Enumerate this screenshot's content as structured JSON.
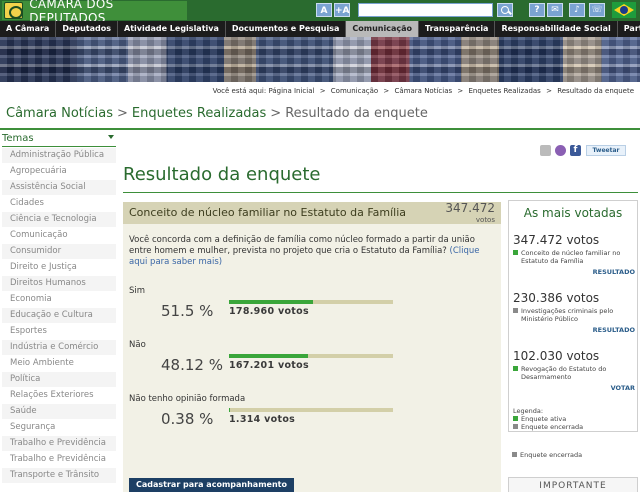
{
  "header": {
    "site_name": "CÂMARA DOS DEPUTADOS",
    "font_small": "A",
    "font_large": "+A",
    "search_placeholder": "",
    "tools": [
      "?",
      "✉",
      "♪",
      "☏"
    ]
  },
  "nav": [
    "A Câmara",
    "Deputados",
    "Atividade Legislativa",
    "Documentos e Pesquisa",
    "Comunicação",
    "Transparência",
    "Responsabilidade Social",
    "Participe"
  ],
  "nav_active_index": 4,
  "breadcrumb": {
    "prefix": "Você está aqui:",
    "items": [
      "Página Inicial",
      "Comunicação",
      "Câmara Notícias",
      "Enquetes Realizadas",
      "Resultado da enquete"
    ],
    "separator": ">"
  },
  "section": {
    "part1": "Câmara Notícias",
    "part2": "Enquetes Realizadas",
    "part3": "Resultado da enquete",
    "separator": ">"
  },
  "sidebar": {
    "title": "Temas",
    "items": [
      "Administração Pública",
      "Agropecuária",
      "Assistência Social",
      "Cidades",
      "Ciência e Tecnologia",
      "Comunicação",
      "Consumidor",
      "Direito e Justiça",
      "Direitos Humanos",
      "Economia",
      "Educação e Cultura",
      "Esportes",
      "Indústria e Comércio",
      "Meio Ambiente",
      "Política",
      "Relações Exteriores",
      "Saúde",
      "Segurança",
      "Trabalho e Previdência",
      "Trabalho e Previdência",
      "Transporte e Trânsito"
    ]
  },
  "share": {
    "tweet_label": "Tweetar"
  },
  "page_title": "Resultado da enquete",
  "poll": {
    "question": "Conceito de núcleo familiar no Estatuto da Família",
    "total_votes": "347.472",
    "total_votes_label": "votos",
    "description": "Você concorda com a definição de família como núcleo formado a partir da união entre homem e mulher, prevista no projeto que cria o Estatuto da Família?",
    "link_text": "(Clique aqui para saber mais)",
    "options": [
      {
        "label": "Sim",
        "percent": "51.5 %",
        "fraction": 0.515,
        "votes": "178.960 votos"
      },
      {
        "label": "Não",
        "percent": "48.12 %",
        "fraction": 0.4812,
        "votes": "167.201 votos"
      },
      {
        "label": "Não tenho opinião formada",
        "percent": "0.38 %",
        "fraction": 0.0038,
        "votes": "1.314 votos"
      }
    ],
    "subscribe_label": "Cadastrar para acompanhamento"
  },
  "most_voted": {
    "title": "As mais votadas",
    "entries": [
      {
        "votes": "347.472 votos",
        "desc": "Conceito de núcleo familiar no Estatuto da Família",
        "action": "RESULTADO",
        "status_color": "#3aa63a"
      },
      {
        "votes": "230.386 votos",
        "desc": "Investigações criminais pelo Ministério Público",
        "action": "RESULTADO",
        "status_color": "#8a8a8a"
      },
      {
        "votes": "102.030 votos",
        "desc": "Revogação do Estatuto do Desarmamento",
        "action": "VOTAR",
        "status_color": "#3aa63a"
      }
    ],
    "legend_title": "Legenda:",
    "legend_active": "Enquete ativa",
    "legend_closed": "Enquete encerrada",
    "active_color": "#3aa63a",
    "closed_color": "#8a8a8a"
  },
  "legend_repeat": "Enquete encerrada",
  "importante": "IMPORTANTE",
  "colors": {
    "brand_green": "#2a6b2f",
    "nav_dark": "#1c1c1c",
    "link_blue": "#3b67a6",
    "bar_green": "#3aa63a"
  }
}
